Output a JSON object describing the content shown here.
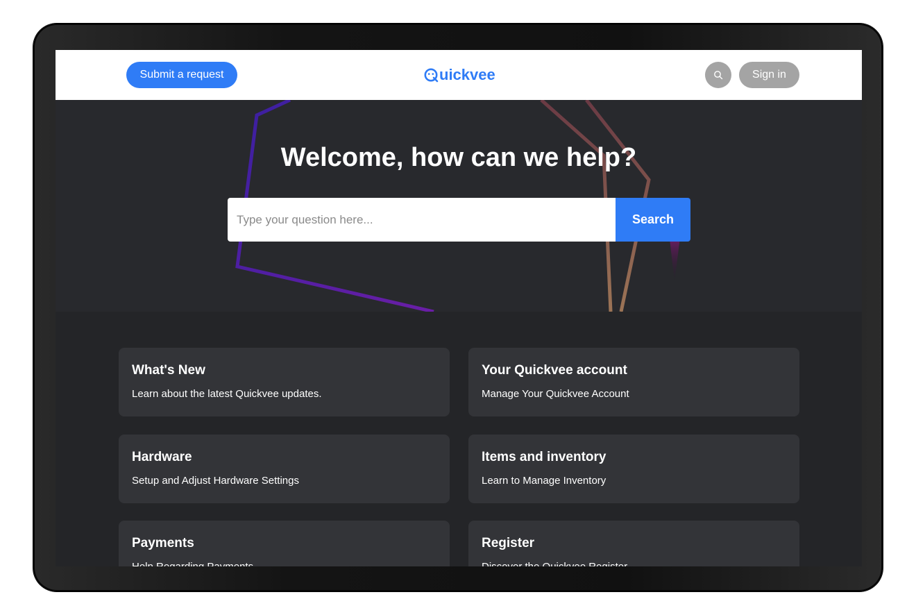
{
  "header": {
    "submit_request_label": "Submit a request",
    "logo_text": "uickvee",
    "sign_in_label": "Sign in"
  },
  "hero": {
    "title": "Welcome, how can we help?",
    "search_placeholder": "Type your question here...",
    "search_button_label": "Search"
  },
  "categories": [
    {
      "title": "What's New",
      "description": "Learn about the latest Quickvee updates."
    },
    {
      "title": "Your Quickvee account",
      "description": "Manage Your Quickvee Account"
    },
    {
      "title": "Hardware",
      "description": "Setup and Adjust Hardware Settings"
    },
    {
      "title": "Items and inventory",
      "description": "Learn to Manage Inventory"
    },
    {
      "title": "Payments",
      "description": "Help Regarding Payments"
    },
    {
      "title": "Register",
      "description": "Discover the Quickvee Register"
    }
  ],
  "colors": {
    "accent": "#2f7cf6",
    "hero_background": "#28292d",
    "page_background": "#242528",
    "card_background": "#333438",
    "muted_button": "#a4a4a4"
  },
  "icons": {
    "search": "search-icon",
    "logo": "quickvee-logo-icon"
  }
}
